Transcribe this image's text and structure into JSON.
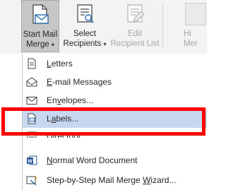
{
  "ribbon": {
    "start_mail_merge": {
      "line1": "Start Mail",
      "line2": "Merge",
      "icon": "start-mail-merge-icon"
    },
    "select_recipients": {
      "line1": "Select",
      "line2": "Recipients",
      "icon": "select-recipients-icon"
    },
    "edit_recipient_list": {
      "line1": "Edit",
      "line2": "Recipient List",
      "icon": "edit-recipient-list-icon"
    },
    "next_group": {
      "line1": "Hi",
      "line2": "Mer"
    }
  },
  "menu": {
    "items": [
      {
        "label": "Letters",
        "mnemonic": "L",
        "icon": "letters-icon"
      },
      {
        "label": "E-mail Messages",
        "mnemonic": "E",
        "icon": "email-icon"
      },
      {
        "label": "Envelopes...",
        "mnemonic": "v",
        "icon": "envelope-icon"
      },
      {
        "label": "Labels...",
        "mnemonic": "a",
        "icon": "labels-icon",
        "highlighted": true
      },
      {
        "label": "Directory",
        "mnemonic": "D",
        "icon": "directory-icon"
      },
      {
        "label": "Normal Word Document",
        "mnemonic": "N",
        "icon": "word-document-icon"
      },
      {
        "label": "Step-by-Step Mail Merge Wizard...",
        "mnemonic": "W",
        "icon": "wizard-icon"
      }
    ]
  },
  "annotation": {
    "color": "#ff0000"
  }
}
